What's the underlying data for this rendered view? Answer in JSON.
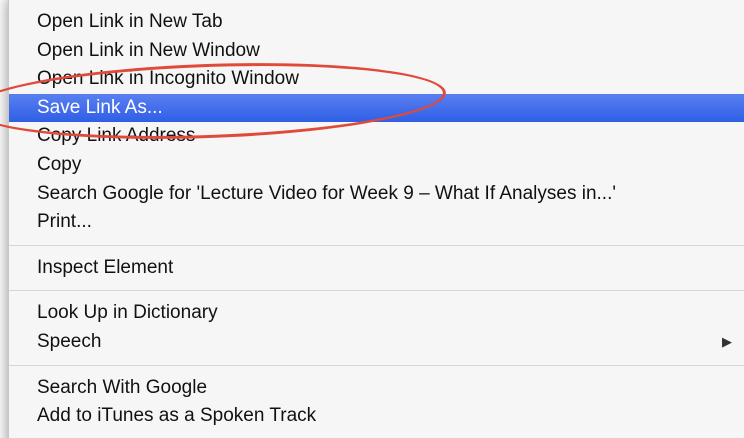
{
  "menu": {
    "group1": [
      {
        "label": "Open Link in New Tab"
      },
      {
        "label": "Open Link in New Window"
      },
      {
        "label": "Open Link in Incognito Window"
      },
      {
        "label": "Save Link As..."
      },
      {
        "label": "Copy Link Address"
      },
      {
        "label": "Copy"
      },
      {
        "label": "Search Google for 'Lecture Video for Week 9 – What If Analyses in...'"
      },
      {
        "label": "Print..."
      }
    ],
    "group2": [
      {
        "label": "Inspect Element"
      }
    ],
    "group3": [
      {
        "label": "Look Up in Dictionary"
      },
      {
        "label": "Speech",
        "submenu_arrow": "▶"
      }
    ],
    "group4": [
      {
        "label": "Search With Google"
      },
      {
        "label": "Add to iTunes as a Spoken Track"
      }
    ]
  },
  "colors": {
    "highlight": "#3a67e8",
    "annotation": "#e04a3a"
  },
  "icons": {
    "submenu": "chevron-right-icon"
  }
}
